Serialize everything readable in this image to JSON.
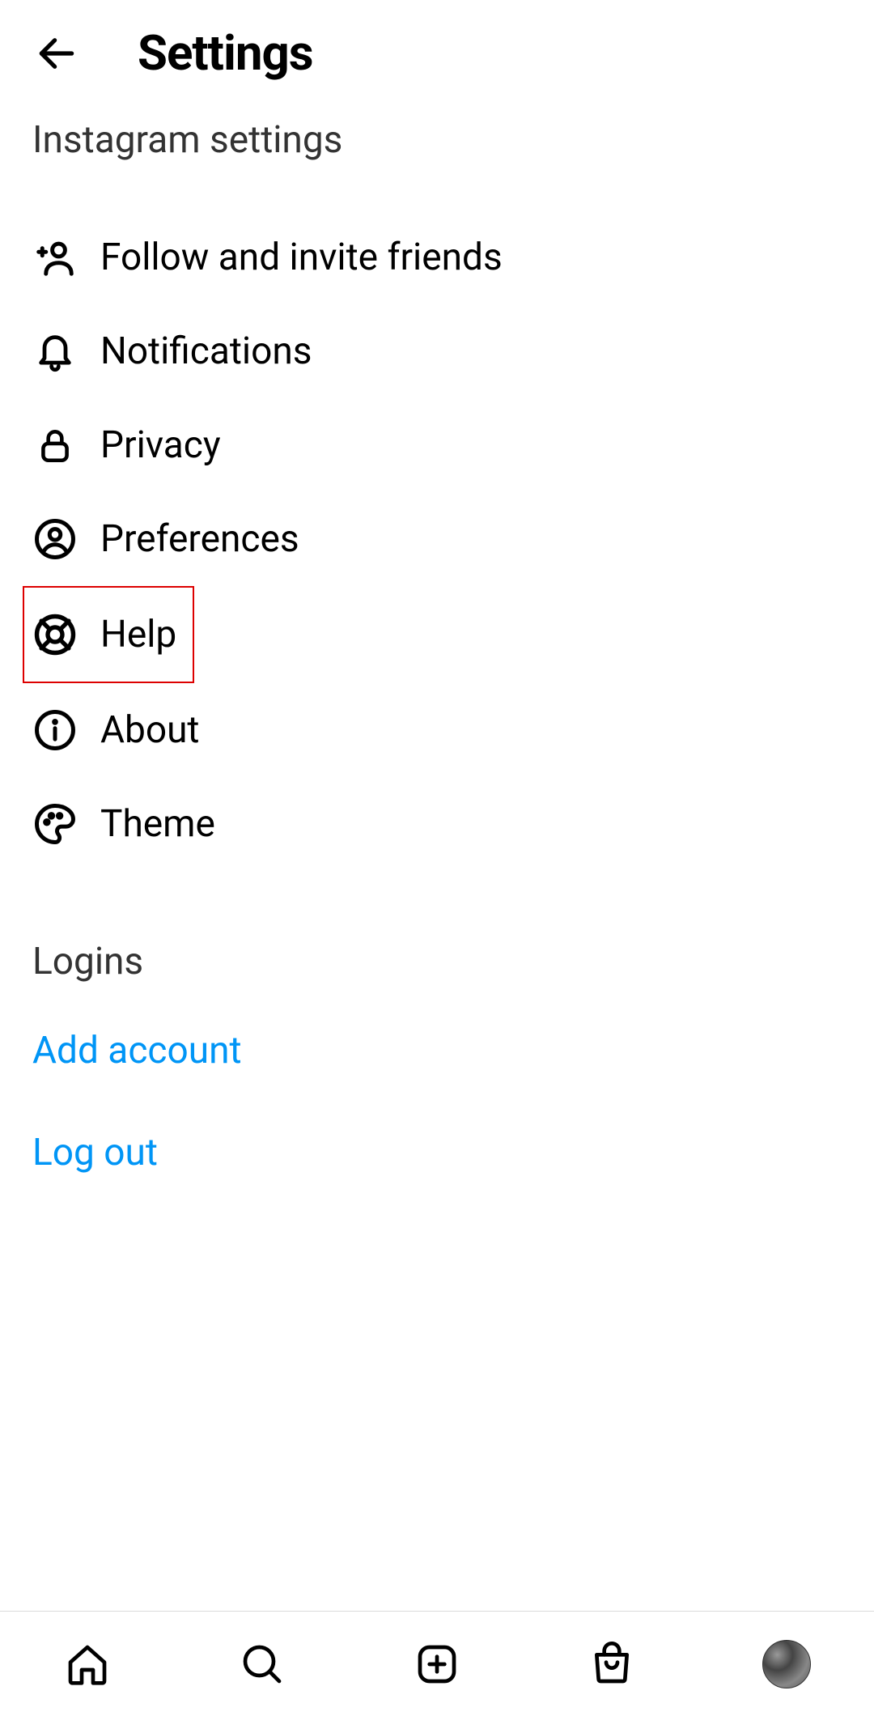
{
  "header": {
    "title": "Settings"
  },
  "sections": {
    "main_title": "Instagram settings",
    "logins_title": "Logins"
  },
  "menu": {
    "items": [
      {
        "label": "Follow and invite friends",
        "icon": "add-person-icon"
      },
      {
        "label": "Notifications",
        "icon": "bell-icon"
      },
      {
        "label": "Privacy",
        "icon": "lock-icon"
      },
      {
        "label": "Preferences",
        "icon": "person-circle-icon"
      },
      {
        "label": "Help",
        "icon": "lifebuoy-icon",
        "highlighted": true
      },
      {
        "label": "About",
        "icon": "info-icon"
      },
      {
        "label": "Theme",
        "icon": "palette-icon"
      }
    ]
  },
  "links": {
    "add_account": "Add account",
    "log_out": "Log out"
  },
  "nav": {
    "home": "home",
    "search": "search",
    "create": "create",
    "shop": "shop",
    "profile": "profile"
  },
  "colors": {
    "link": "#0095f6",
    "highlight_border": "#d00"
  }
}
